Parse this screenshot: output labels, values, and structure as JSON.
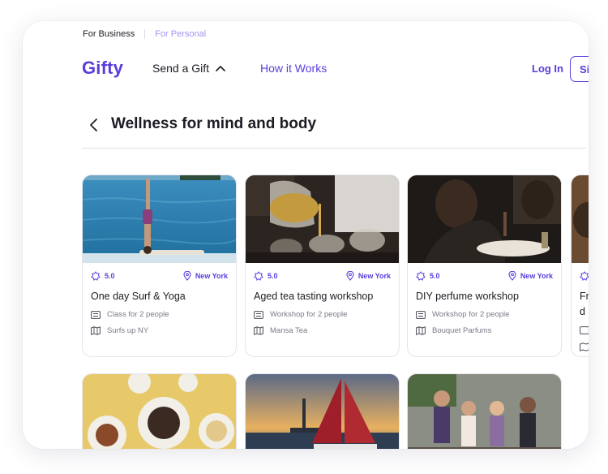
{
  "topbar": {
    "business": "For Business",
    "personal": "For Personal"
  },
  "header": {
    "logo": "Gifty",
    "send_gift": "Send a Gift",
    "how_it_works": "How it Works",
    "login": "Log In",
    "signup": "Si"
  },
  "page": {
    "title": "Wellness for mind and body"
  },
  "colors": {
    "brand": "#5b3ddb",
    "muted": "#7a7a88",
    "border": "#e4e4ec"
  },
  "cards": [
    {
      "rating": "5.0",
      "location": "New York",
      "name": "One day Surf & Yoga",
      "detail": "Class for 2 people",
      "venue": "Surfs up NY"
    },
    {
      "rating": "5.0",
      "location": "New York",
      "name": "Aged tea tasting workshop",
      "detail": "Workshop for 2 people",
      "venue": "Mansa Tea"
    },
    {
      "rating": "5.0",
      "location": "New York",
      "name": "DIY perfume workshop",
      "detail": "Workshop for 2 people",
      "venue": "Bouquet Parfums"
    },
    {
      "name_1": "Fr",
      "name_2": "d"
    }
  ],
  "icons": [
    "chevron-up-icon",
    "back-chevron-icon",
    "badge-star-icon",
    "location-pin-icon",
    "ticket-icon",
    "map-icon"
  ]
}
